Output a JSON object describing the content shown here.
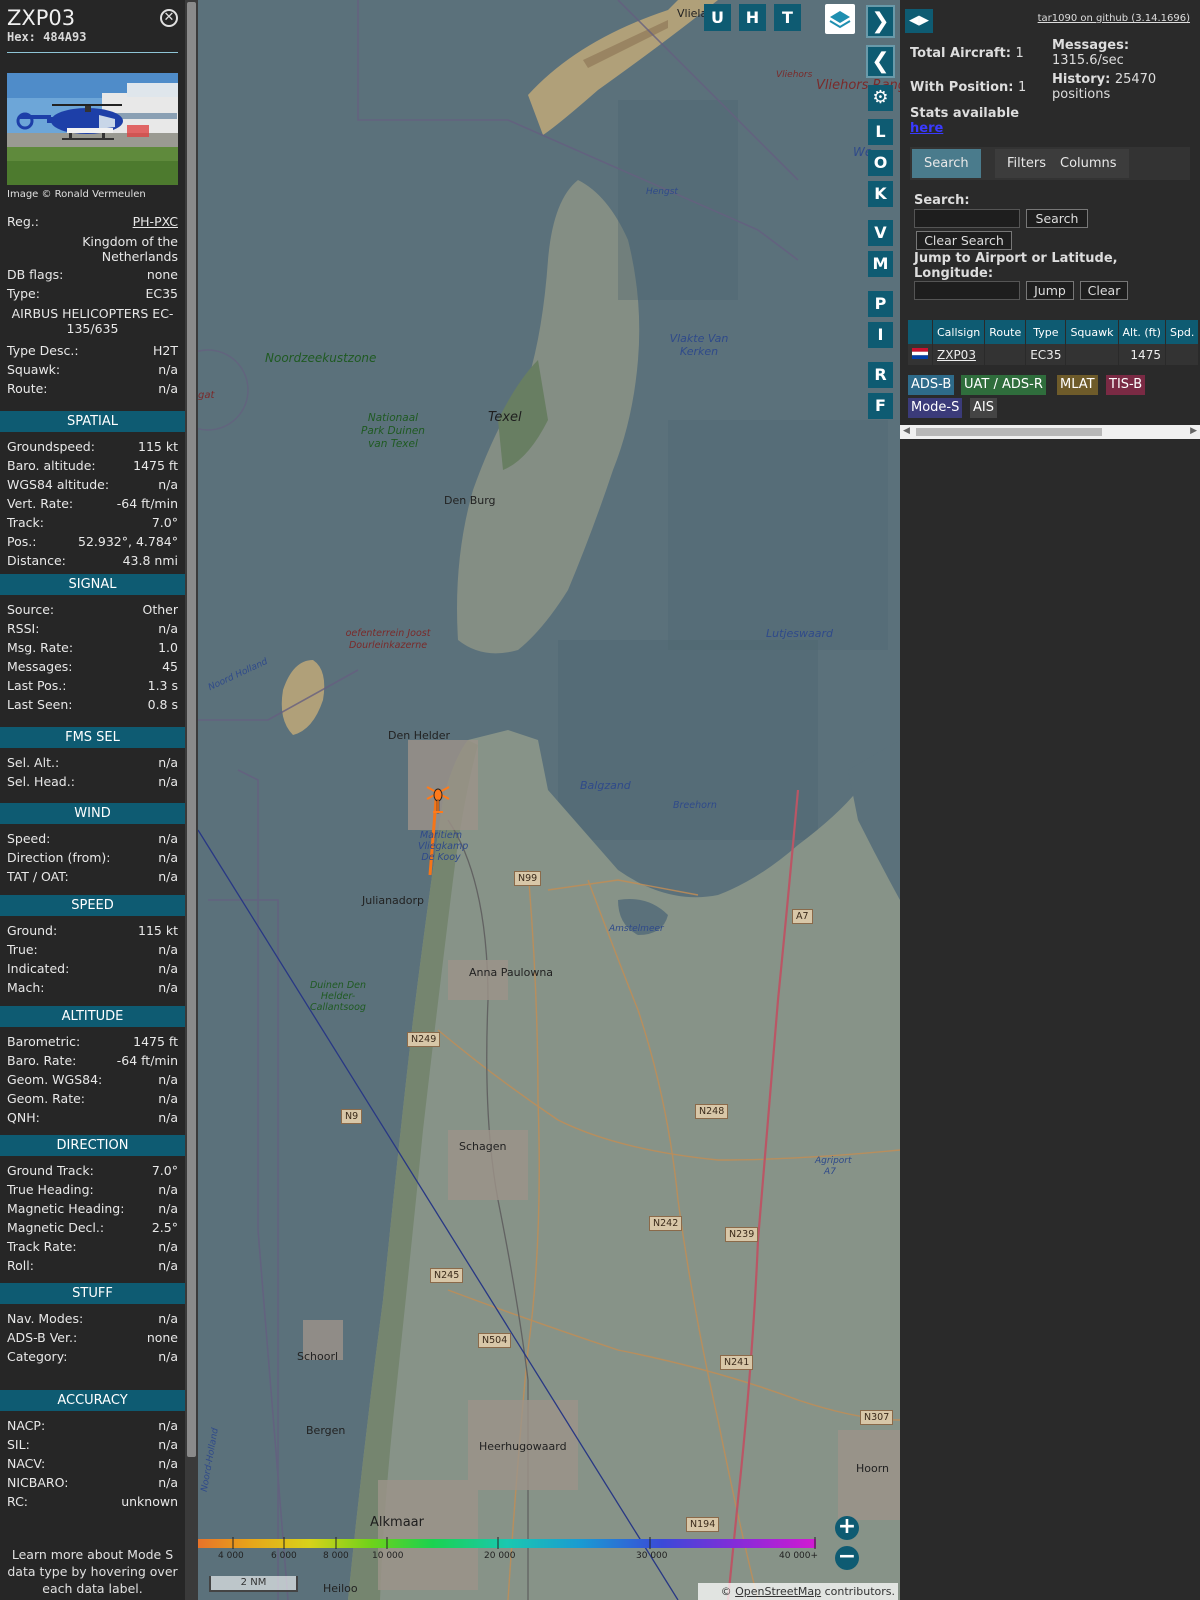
{
  "aircraft": {
    "callsign": "ZXP03",
    "hex": "Hex: 484A93",
    "image_credit": "Image © Ronald Vermeulen",
    "rows_top": [
      {
        "k": "Reg.:",
        "v": "PH-PXC"
      },
      {
        "k": "",
        "v": "Kingdom of the Netherlands"
      },
      {
        "k": "DB flags:",
        "v": "none"
      },
      {
        "k": "Type:",
        "v": "EC35"
      },
      {
        "k": "",
        "v": "AIRBUS HELICOPTERS EC-135/635"
      },
      {
        "k": "Type Desc.:",
        "v": "H2T"
      },
      {
        "k": "Squawk:",
        "v": "n/a"
      },
      {
        "k": "Route:",
        "v": "n/a"
      }
    ]
  },
  "sections": {
    "spatial": {
      "title": "SPATIAL",
      "rows": [
        {
          "k": "Groundspeed:",
          "v": "115 kt"
        },
        {
          "k": "Baro. altitude:",
          "v": "1475 ft"
        },
        {
          "k": "WGS84 altitude:",
          "v": "n/a"
        },
        {
          "k": "Vert. Rate:",
          "v": "-64 ft/min"
        },
        {
          "k": "Track:",
          "v": "7.0°"
        },
        {
          "k": "Pos.:",
          "v": "52.932°, 4.784°"
        },
        {
          "k": "Distance:",
          "v": "43.8 nmi"
        }
      ]
    },
    "signal": {
      "title": "SIGNAL",
      "rows": [
        {
          "k": "Source:",
          "v": "Other"
        },
        {
          "k": "RSSI:",
          "v": "n/a"
        },
        {
          "k": "Msg. Rate:",
          "v": "1.0"
        },
        {
          "k": "Messages:",
          "v": "45"
        },
        {
          "k": "Last Pos.:",
          "v": "1.3 s"
        },
        {
          "k": "Last Seen:",
          "v": "0.8 s"
        }
      ]
    },
    "fms": {
      "title": "FMS SEL",
      "rows": [
        {
          "k": "Sel. Alt.:",
          "v": "n/a"
        },
        {
          "k": "Sel. Head.:",
          "v": "n/a"
        }
      ]
    },
    "wind": {
      "title": "WIND",
      "rows": [
        {
          "k": "Speed:",
          "v": "n/a"
        },
        {
          "k": "Direction (from):",
          "v": "n/a"
        },
        {
          "k": "TAT / OAT:",
          "v": "n/a"
        }
      ]
    },
    "speed": {
      "title": "SPEED",
      "rows": [
        {
          "k": "Ground:",
          "v": "115 kt"
        },
        {
          "k": "True:",
          "v": "n/a"
        },
        {
          "k": "Indicated:",
          "v": "n/a"
        },
        {
          "k": "Mach:",
          "v": "n/a"
        }
      ]
    },
    "altitude": {
      "title": "ALTITUDE",
      "rows": [
        {
          "k": "Barometric:",
          "v": "1475 ft"
        },
        {
          "k": "Baro. Rate:",
          "v": "-64 ft/min"
        },
        {
          "k": "Geom. WGS84:",
          "v": "n/a"
        },
        {
          "k": "Geom. Rate:",
          "v": "n/a"
        },
        {
          "k": "QNH:",
          "v": "n/a"
        }
      ]
    },
    "direction": {
      "title": "DIRECTION",
      "rows": [
        {
          "k": "Ground Track:",
          "v": "7.0°"
        },
        {
          "k": "True Heading:",
          "v": "n/a"
        },
        {
          "k": "Magnetic Heading:",
          "v": "n/a"
        },
        {
          "k": "Magnetic Decl.:",
          "v": "2.5°"
        },
        {
          "k": "Track Rate:",
          "v": "n/a"
        },
        {
          "k": "Roll:",
          "v": "n/a"
        }
      ]
    },
    "stuff": {
      "title": "STUFF",
      "rows": [
        {
          "k": "Nav. Modes:",
          "v": "n/a"
        },
        {
          "k": "ADS-B Ver.:",
          "v": "none"
        },
        {
          "k": "Category:",
          "v": "n/a"
        }
      ]
    },
    "accuracy": {
      "title": "ACCURACY",
      "rows": [
        {
          "k": "NACP:",
          "v": "n/a"
        },
        {
          "k": "SIL:",
          "v": "n/a"
        },
        {
          "k": "NACV:",
          "v": "n/a"
        },
        {
          "k": "NICBARO:",
          "v": "n/a"
        },
        {
          "k": "RC:",
          "v": "unknown"
        }
      ]
    }
  },
  "learn_more": "Learn more about Mode S data type by hovering over each data label.",
  "map": {
    "top_buttons": [
      "U",
      "H",
      "T"
    ],
    "side_buttons": [
      "L",
      "O",
      "K",
      "V",
      "M",
      "P",
      "I",
      "R",
      "F"
    ],
    "labels": {
      "vliehors_range": "Vliehors Range",
      "vliehors": "Vliehors",
      "vliela": "Vliela",
      "noordzeekustzone": "Noordzeekustzone",
      "texel": "Texel",
      "park": "Nationaal Park Duinen van Texel",
      "den_burg": "Den Burg",
      "oefenterrein": "oefenterrein Joost Dourleinkazerne",
      "den_helder": "Den Helder",
      "marine": "Maritiem Vliegkamp De Kooy",
      "julianadorp": "Julianadorp",
      "anna_paulowna": "Anna Paulowna",
      "duinen": "Duinen Den Helder-Callantsoog",
      "schagen": "Schagen",
      "schoorl": "Schoorl",
      "bergen": "Bergen",
      "heerhugowaard": "Heerhugowaard",
      "alkmaar": "Alkmaar",
      "heiloo": "Heiloo",
      "hoorn": "Hoorn",
      "vlakte": "Vlakte Van Kerken",
      "lutjeswaard": "Lutjeswaard",
      "balgzand": "Balgzand",
      "breehorn": "Breehorn",
      "amstelmeer": "Amstelmeer",
      "agriport": "Agriport A7",
      "hengst": "Hengst",
      "noord_holland": "Noord Holland",
      "noord_holland2": "Noord-Holland",
      "gat": "gat",
      "we": "We"
    },
    "roads": [
      "N99",
      "A7",
      "N249",
      "N248",
      "N9",
      "N242",
      "N239",
      "N245",
      "N504",
      "N241",
      "N307",
      "N194"
    ],
    "altitude_scale": [
      "4 000",
      "6 000",
      "8 000",
      "10 000",
      "20 000",
      "30 000",
      "40 000+"
    ],
    "scale_bar": "2 NM",
    "attribution_prefix": "© ",
    "attribution_link": "OpenStreetMap",
    "attribution_suffix": " contributors."
  },
  "right": {
    "github": "tar1090 on github (3.14.1696)",
    "total_aircraft_label": "Total Aircraft:",
    "total_aircraft": "1",
    "with_position_label": "With Position:",
    "with_position": "1",
    "messages_label": "Messages:",
    "messages": "1315.6/sec",
    "history_label": "History:",
    "history": "25470 positions",
    "stats_label": "Stats available",
    "stats_link": "here",
    "tabs": [
      "Search",
      "Filters",
      "Columns"
    ],
    "search_label": "Search:",
    "search_button": "Search",
    "clear_search_button": "Clear Search",
    "jump_label": "Jump to Airport or Latitude, Longitude:",
    "jump_button": "Jump",
    "clear_button": "Clear",
    "table_headers": [
      "",
      "Callsign",
      "Route",
      "Type",
      "Squawk",
      "Alt. (ft)",
      "Spd."
    ],
    "table_row": {
      "callsign": "ZXP03",
      "route": "",
      "type": "EC35",
      "squawk": "",
      "alt": "1475",
      "spd": ""
    },
    "badges": [
      {
        "label": "ADS-B",
        "color": "#2e6b8a"
      },
      {
        "label": "UAT / ADS-R",
        "color": "#2f6d3c"
      },
      {
        "label": "MLAT",
        "color": "#6e5b2a"
      },
      {
        "label": "TIS-B",
        "color": "#7a2a44"
      },
      {
        "label": "Mode-S",
        "color": "#3b3b7a"
      },
      {
        "label": "AIS",
        "color": "#444444"
      }
    ]
  },
  "colors": {
    "accent": "#0e5b72",
    "track": "#ff7a1a",
    "panel": "#262626"
  }
}
